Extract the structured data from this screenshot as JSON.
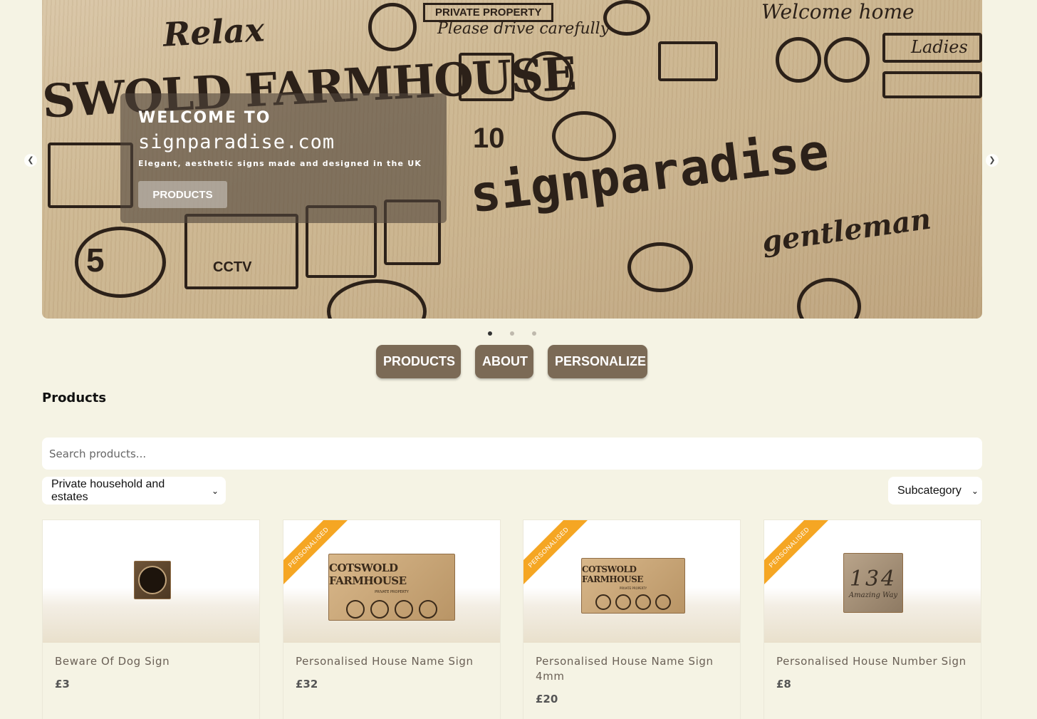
{
  "hero": {
    "kicker": "WELCOME TO",
    "domain": "signparadise.com",
    "tagline": "Elegant, aesthetic signs made and designed in the UK",
    "cta": "PRODUCTS",
    "prev_icon": "chevron-left-icon",
    "next_icon": "chevron-right-icon",
    "slide_count": 3,
    "active_slide": 1,
    "engravings": {
      "relax": "Relax",
      "private": "PRIVATE PROPERTY",
      "please": "Please drive carefully",
      "welcome": "Welcome home",
      "farmhouse": "SWOLD FARMHOUSE",
      "cctv": "CCTV",
      "speed": "5",
      "ten": "10",
      "brand": "signparadise",
      "gentleman": "gentleman",
      "ladies": "Ladies"
    }
  },
  "main_nav": {
    "products": "PRODUCTS",
    "about": "ABOUT",
    "personalize": "PERSONALIZE"
  },
  "products_section": {
    "title": "Products",
    "search_placeholder": "Search products...",
    "category_select": "Private household and estates",
    "subcategory_select": "Subcategory"
  },
  "products": [
    {
      "name": "Beware Of Dog Sign",
      "price": "£3",
      "personalised": false
    },
    {
      "name": "Personalised House Name Sign",
      "price": "£32",
      "personalised": true,
      "ribbon": "PERSONALISED",
      "sign_text": "COTSWOLD FARMHOUSE",
      "sign_sub": "PRIVATE PROPERTY"
    },
    {
      "name": "Personalised House Name Sign 4mm",
      "price": "£20",
      "personalised": true,
      "ribbon": "PERSONALISED",
      "sign_text": "COTSWOLD FARMHOUSE",
      "sign_sub": "PRIVATE PROPERTY"
    },
    {
      "name": "Personalised House Number Sign",
      "price": "£8",
      "personalised": true,
      "ribbon": "PERSONALISED",
      "sign_number": "134",
      "sign_street": "Amazing Way"
    }
  ],
  "colors": {
    "background": "#f5f3e4",
    "nav_button": "#7b6a56",
    "ribbon": "#f5a623"
  }
}
